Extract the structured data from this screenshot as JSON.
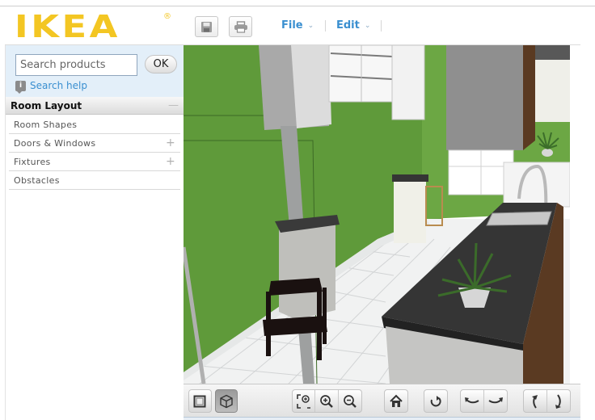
{
  "brand": {
    "logo_text": "IKEA",
    "registered": "®",
    "logo_color": "#f3c623"
  },
  "toolbar": {
    "save_icon": "floppy-disk-icon",
    "print_icon": "printer-icon",
    "menus": [
      {
        "label": "File",
        "chevron": "⌄"
      },
      {
        "label": "Edit",
        "chevron": "⌄"
      }
    ],
    "link_color": "#3a8fd0"
  },
  "search": {
    "placeholder": "Search products",
    "value": "",
    "ok_label": "OK",
    "help_label": "Search help",
    "help_icon": "info-bubble-icon"
  },
  "sidebar": {
    "section_title": "Room Layout",
    "section_toggle": "—",
    "items": [
      {
        "label": "Room Shapes",
        "expand": ""
      },
      {
        "label": "Doors & Windows",
        "expand": "+"
      },
      {
        "label": "Fixtures",
        "expand": "+"
      },
      {
        "label": "Obstacles",
        "expand": ""
      }
    ]
  },
  "viewport": {
    "description": "3D kitchen view",
    "wall_color": "#5f9a3a",
    "floor_color": "#f2f2f2",
    "countertop_color": "#3a3a3a",
    "cabinet_front_color": "#5a3a22"
  },
  "bottom_toolbar": {
    "view_modes": [
      {
        "name": "2d-view",
        "icon": "square-icon",
        "active": false
      },
      {
        "name": "3d-view",
        "icon": "cube-icon",
        "active": true
      }
    ],
    "zoom": [
      {
        "name": "zoom-fit",
        "icon": "zoom-fit-icon"
      },
      {
        "name": "zoom-in",
        "icon": "zoom-in-icon"
      },
      {
        "name": "zoom-out",
        "icon": "zoom-out-icon"
      }
    ],
    "home": {
      "icon": "home-icon"
    },
    "reset_rotation": {
      "icon": "rotate-reset-icon"
    },
    "rotate_horizontal": [
      {
        "name": "rotate-left",
        "icon": "rotate-left-icon"
      },
      {
        "name": "rotate-right",
        "icon": "rotate-right-icon"
      }
    ],
    "tilt": [
      {
        "name": "tilt-up",
        "icon": "tilt-up-icon"
      },
      {
        "name": "tilt-down",
        "icon": "tilt-down-icon"
      }
    ]
  }
}
